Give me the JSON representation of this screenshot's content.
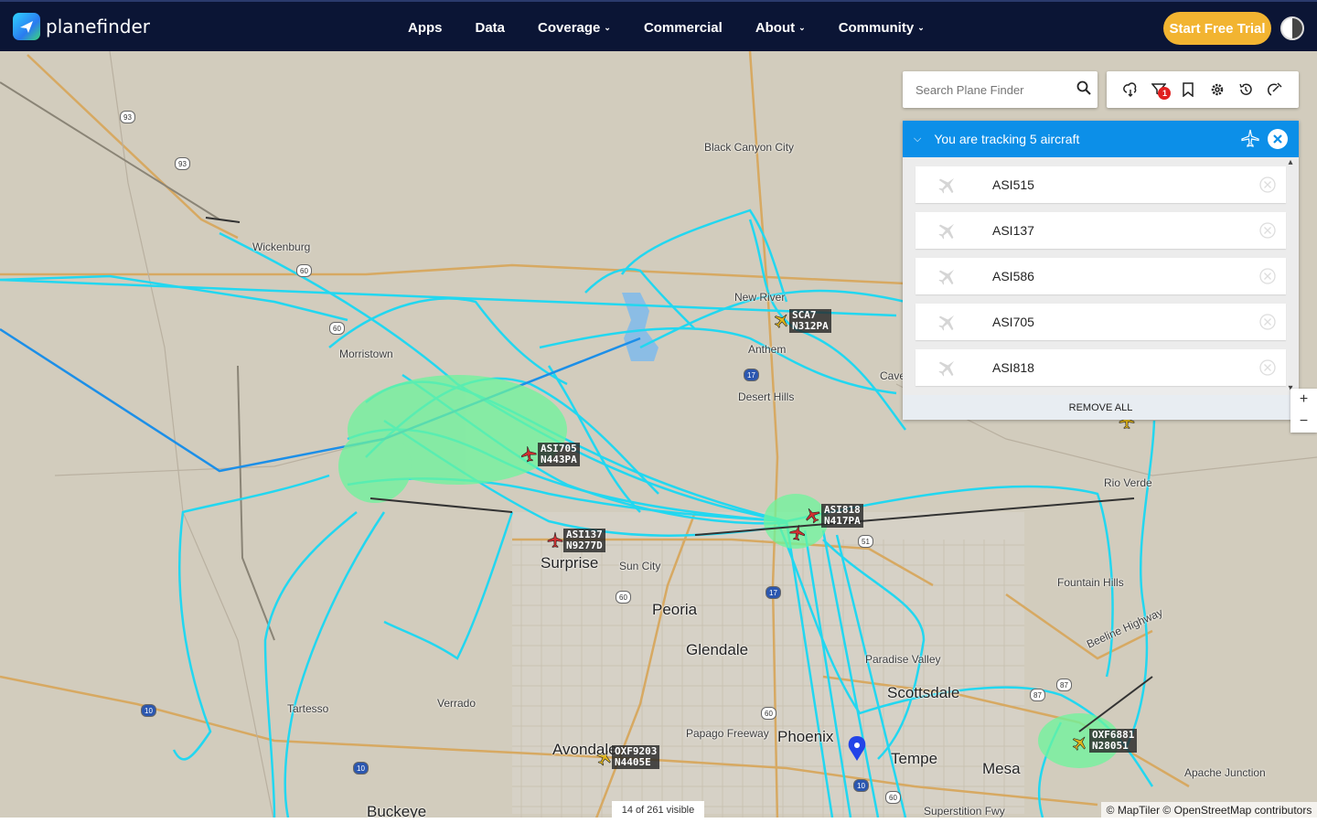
{
  "brand": {
    "name": "planefinder"
  },
  "nav": {
    "links": [
      {
        "label": "Apps",
        "has_menu": false
      },
      {
        "label": "Data",
        "has_menu": false
      },
      {
        "label": "Coverage",
        "has_menu": true
      },
      {
        "label": "Commercial",
        "has_menu": false
      },
      {
        "label": "About",
        "has_menu": true
      },
      {
        "label": "Community",
        "has_menu": true
      }
    ],
    "trial_label": "Start Free Trial"
  },
  "search": {
    "placeholder": "Search Plane Finder"
  },
  "toolbar": {
    "icons": [
      "weather-icon",
      "filter-icon",
      "bookmark-icon",
      "settings-icon",
      "history-icon",
      "radar-icon"
    ],
    "filter_badge": "1"
  },
  "tracking": {
    "header": "You are tracking 5 aircraft",
    "aircraft": [
      "ASI515",
      "ASI137",
      "ASI586",
      "ASI705",
      "ASI818"
    ],
    "remove_all_label": "REMOVE ALL"
  },
  "map": {
    "places": [
      {
        "name": "Black Canyon City",
        "size": "small"
      },
      {
        "name": "Wickenburg",
        "size": "small"
      },
      {
        "name": "New River",
        "size": "small"
      },
      {
        "name": "Anthem",
        "size": "small"
      },
      {
        "name": "Morristown",
        "size": "small"
      },
      {
        "name": "Desert Hills",
        "size": "small"
      },
      {
        "name": "Cave Creek",
        "size": "small"
      },
      {
        "name": "Rio Verde",
        "size": "small"
      },
      {
        "name": "Surprise",
        "size": "big"
      },
      {
        "name": "Sun City",
        "size": "small"
      },
      {
        "name": "Fountain Hills",
        "size": "small"
      },
      {
        "name": "Peoria",
        "size": "big"
      },
      {
        "name": "Glendale",
        "size": "big"
      },
      {
        "name": "Paradise Valley",
        "size": "small"
      },
      {
        "name": "Scottsdale",
        "size": "big"
      },
      {
        "name": "Tartesso",
        "size": "small"
      },
      {
        "name": "Verrado",
        "size": "small"
      },
      {
        "name": "Papago Freeway",
        "size": "small"
      },
      {
        "name": "Phoenix",
        "size": "big"
      },
      {
        "name": "Avondale",
        "size": "big"
      },
      {
        "name": "Tempe",
        "size": "big"
      },
      {
        "name": "Mesa",
        "size": "big"
      },
      {
        "name": "Apache Junction",
        "size": "small"
      },
      {
        "name": "Buckeye",
        "size": "big"
      },
      {
        "name": "Superstition Fwy",
        "size": "small"
      },
      {
        "name": "Beeline Highway",
        "size": "small"
      }
    ],
    "road_shields": [
      "93",
      "93",
      "60",
      "60",
      "17",
      "51",
      "17",
      "60",
      "10",
      "10",
      "60",
      "10",
      "60",
      "87",
      "87"
    ],
    "aircraft_labels": [
      {
        "callsign": "SCA7",
        "reg": "N312PA"
      },
      {
        "callsign": "ASI705",
        "reg": "N443PA"
      },
      {
        "callsign": "ASI818",
        "reg": "N417PA"
      },
      {
        "callsign": "ASI137",
        "reg": "N9277D"
      },
      {
        "callsign": "OXF9203",
        "reg": "N4405E"
      },
      {
        "callsign": "OXF6881",
        "reg": "N28051"
      }
    ],
    "visible_count": "14 of 261 visible",
    "attribution": "© MapTiler © OpenStreetMap contributors",
    "zoom_in": "+",
    "zoom_out": "−"
  },
  "colors": {
    "nav_bg": "#0b1535",
    "trial": "#f2b431",
    "track_cyan": "#22d7f0",
    "track_green": "#5ef59a",
    "panel_head": "#0c8fe8"
  }
}
